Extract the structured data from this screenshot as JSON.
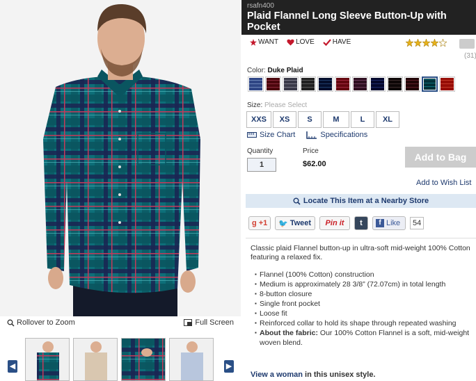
{
  "product": {
    "sku": "rsafn400",
    "title": "Plaid Flannel Long Sleeve Button-Up with Pocket"
  },
  "actions": {
    "want": "WANT",
    "love": "LOVE",
    "have": "HAVE"
  },
  "rating": {
    "stars": 4,
    "max": 5,
    "review_count": "(31)"
  },
  "color": {
    "label": "Color:",
    "selected": "Duke Plaid",
    "swatch_colors": [
      "#6d86b8",
      "#8a2a3a",
      "#7a7a88",
      "#5a5a5a",
      "#1f3c6a",
      "#a02a3e",
      "#6b3c5a",
      "#1f2a6a",
      "#3a2b2b",
      "#5c1f28",
      "#0d6e78",
      "#c43a2a"
    ]
  },
  "size": {
    "label": "Size:",
    "placeholder": "Please Select",
    "options": [
      "XXS",
      "XS",
      "S",
      "M",
      "L",
      "XL"
    ]
  },
  "links": {
    "size_chart": "Size Chart",
    "specifications": "Specifications"
  },
  "purchase": {
    "quantity_label": "Quantity",
    "quantity": "1",
    "price_label": "Price",
    "price": "$62.00",
    "add_to_bag": "Add to Bag",
    "add_to_wishlist": "Add to Wish List"
  },
  "locate": "Locate This Item at a Nearby Store",
  "social": {
    "gplus": "+1",
    "tweet": "Tweet",
    "pinit": "Pin it",
    "tumblr": "t",
    "like": "Like",
    "like_count": "54"
  },
  "description": "Classic plaid Flannel button-up in ultra-soft mid-weight 100% Cotton featuring a relaxed fix.",
  "features": [
    "Flannel (100% Cotton) construction",
    "Medium is approximately 28 3/8” (72.07cm) in total length",
    "8-button closure",
    "Single front pocket",
    "Loose fit",
    "Reinforced collar to hold its shape through repeated washing"
  ],
  "fabric": {
    "label": "About the fabric:",
    "text": " Our 100% Cotton Flannel is a soft, mid-weight woven blend."
  },
  "view_woman": {
    "link": "View a woman",
    "rest": " in this unisex style."
  },
  "image_controls": {
    "rollover": "Rollover to Zoom",
    "fullscreen": "Full Screen"
  },
  "colors": {
    "accent": "#1e3a6e",
    "title_bg": "#222222",
    "locate_bg": "#dde8f3",
    "shirt_base": "#0d6e78",
    "shirt_line_red": "#c43a5a",
    "shirt_line_navy": "#1a2552"
  }
}
